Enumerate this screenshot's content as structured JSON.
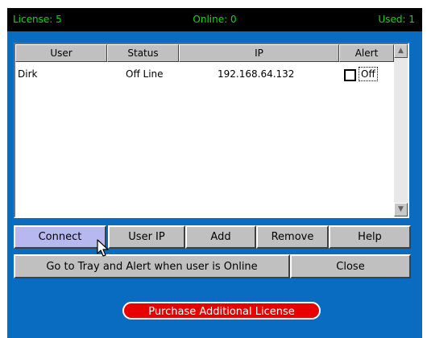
{
  "status_bar": {
    "license": "License: 5",
    "online": "Online: 0",
    "used": "Used: 1"
  },
  "user_list": {
    "columns": [
      "User",
      "Status",
      "IP",
      "Alert"
    ],
    "rows": [
      {
        "user": "Dirk",
        "status": "Off Line",
        "ip": "192.168.64.132",
        "alert": "Off",
        "alert_checked": false
      }
    ]
  },
  "buttons": {
    "connect": "Connect",
    "user_ip": "User IP",
    "add": "Add",
    "remove": "Remove",
    "help": "Help",
    "tray_alert": "Go to Tray and Alert when user is Online",
    "close": "Close",
    "purchase": "Purchase Additional License"
  },
  "colors": {
    "panel_bg": "#0a6cc0",
    "status_text": "#00e000",
    "purchase_bg": "#e80000",
    "focused_button": "#b8b8f0"
  }
}
